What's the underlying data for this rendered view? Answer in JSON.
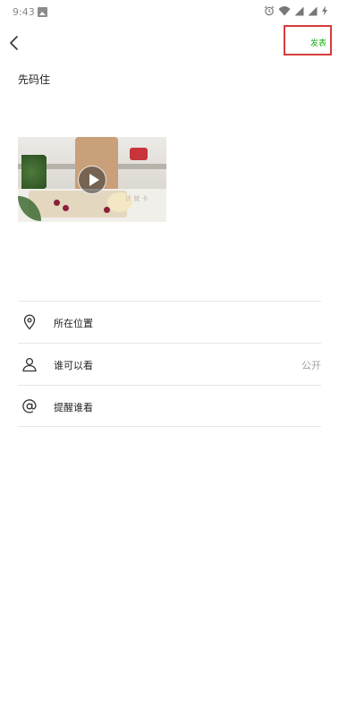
{
  "status_bar": {
    "time": "9:43",
    "icons": [
      "gallery-icon",
      "alarm-icon",
      "wifi-icon",
      "signal-icon",
      "signal-icon",
      "charging-icon"
    ]
  },
  "nav": {
    "back_icon": "chevron-left-icon",
    "publish_label": "发表",
    "publish_color": "#1aad19",
    "highlight_color": "#d93a3a"
  },
  "post": {
    "text": "先码住",
    "video_caption": "计 就 卡"
  },
  "options": [
    {
      "icon": "location-pin-icon",
      "label": "所在位置",
      "value": ""
    },
    {
      "icon": "person-icon",
      "label": "谁可以看",
      "value": "公开"
    },
    {
      "icon": "at-icon",
      "label": "提醒谁看",
      "value": ""
    }
  ]
}
